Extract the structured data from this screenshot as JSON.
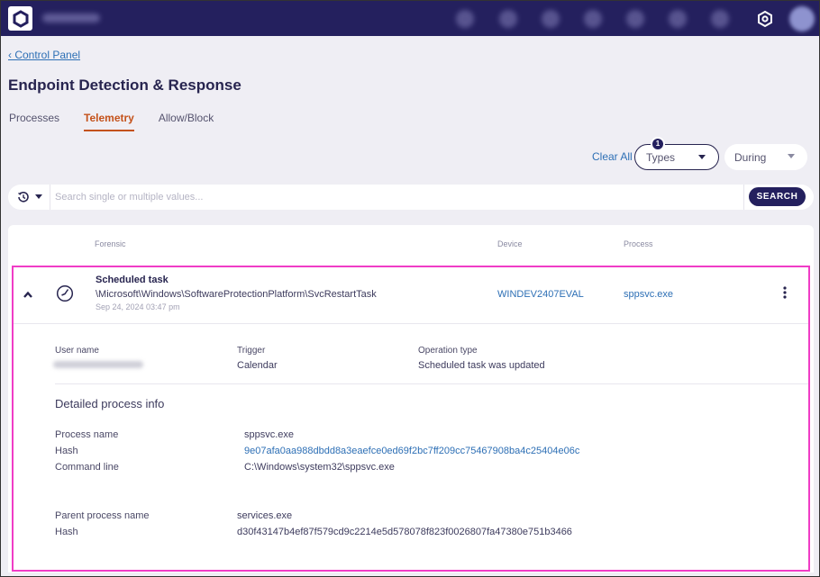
{
  "topbar": {
    "logo_icon": "hexagon-logo-icon",
    "brand_name_redacted": true,
    "nav_icons_redacted": 7,
    "settings_icon": "gear-icon",
    "avatar_redacted": true
  },
  "breadcrumb": {
    "back_label": "‹ Control Panel"
  },
  "page": {
    "title": "Endpoint Detection & Response"
  },
  "tabs": [
    {
      "label": "Processes",
      "active": false
    },
    {
      "label": "Telemetry",
      "active": true
    },
    {
      "label": "Allow/Block",
      "active": false
    }
  ],
  "filters": {
    "clear_all_label": "Clear All",
    "types": {
      "label": "Types",
      "badge_count": "1"
    },
    "during": {
      "label": "During"
    }
  },
  "search": {
    "history_icon": "history-icon",
    "placeholder": "Search single or multiple values...",
    "value": "",
    "button_label": "SEARCH"
  },
  "table": {
    "columns": {
      "forensic": "Forensic",
      "device": "Device",
      "process": "Process"
    },
    "rows": [
      {
        "expanded": true,
        "type_icon": "clock-icon",
        "title": "Scheduled task",
        "path": "\\Microsoft\\Windows\\SoftwareProtectionPlatform\\SvcRestartTask",
        "timestamp": "Sep 24, 2024 03:47 pm",
        "device": "WINDEV2407EVAL",
        "process": "sppsvc.exe",
        "details": {
          "user_name_label": "User name",
          "user_name_redacted": true,
          "trigger_label": "Trigger",
          "trigger_value": "Calendar",
          "operation_type_label": "Operation type",
          "operation_type_value": "Scheduled task was updated",
          "section_title": "Detailed process info",
          "process_name_label": "Process name",
          "process_name_value": "sppsvc.exe",
          "hash_label": "Hash",
          "hash_value": "9e07afa0aa988dbdd8a3eaefce0ed69f2bc7ff209cc75467908ba4c25404e06c",
          "command_line_label": "Command line",
          "command_line_value": "C:\\Windows\\system32\\sppsvc.exe",
          "parent_process_name_label": "Parent process name",
          "parent_process_name_value": "services.exe",
          "parent_hash_label": "Hash",
          "parent_hash_value": "d30f43147b4ef87f579cd9c2214e5d578078f823f0026807fa47380e751b3466"
        }
      }
    ]
  },
  "colors": {
    "nav_bg": "#24205e",
    "accent_tab": "#c4521b",
    "link": "#2d6fb5",
    "highlight_border": "#f03cc6",
    "page_bg": "#efeef4"
  }
}
